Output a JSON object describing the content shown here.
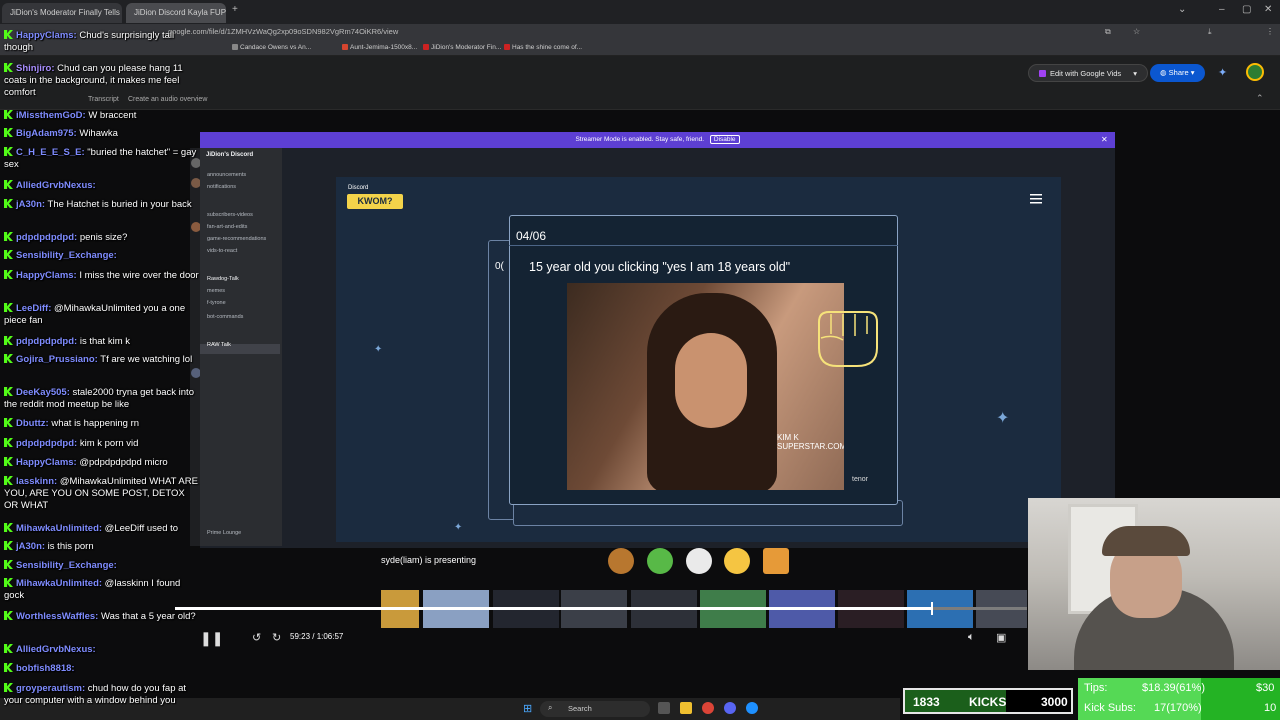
{
  "browser": {
    "tabs": [
      "JiDion's Moderator Finally Tells",
      "JiDion Discord Kayla FUP"
    ],
    "address": "google.com/file/d/1ZMHVzWaQg2xp09oSDN982VgRm74OiKR6/view",
    "bookmarks": [
      "Candace Owens vs An...",
      "Aunt-Jemima-1500x8...",
      "JiDion's Moderator Fin...",
      "Has the shine come of..."
    ]
  },
  "drive": {
    "transcript_label": "Transcript",
    "audio_overview_label": "Create an audio overview",
    "edit_vids_label": "Edit with Google Vids",
    "share_label": "Share"
  },
  "discord": {
    "streamer_banner": "Streamer Mode is enabled. Stay safe, friend.",
    "disable_label": "Disable",
    "server_name": "JiDion's Discord",
    "channels": [
      "announcements",
      "notifications",
      "subscribers-videos",
      "fan-art-and-edits",
      "game-recommendations",
      "vids-to-react",
      "Rawdog-Talk",
      "memes",
      "f-tyrone",
      "bot-commands",
      "RAW Talk"
    ],
    "voice_channel": "Prime Lounge",
    "presenting_text": "syde(liam) is presenting"
  },
  "activity": {
    "logo_small": "Discord",
    "logo": "KWOM?",
    "counter": "04/06",
    "behind_counter": "0(",
    "prompt": "15 year old you clicking \"yes I am 18 years old\"",
    "gif_watermark": "KIM K SUPERSTAR.COM",
    "gif_source": "tenor"
  },
  "player": {
    "time": "59:23 / 1:06:57",
    "progress": 0.887
  },
  "chat": [
    {
      "user": "HappyClams",
      "color": "#7f8cff",
      "text": "Chud's surprisingly tall though"
    },
    {
      "user": "Shinjiro",
      "color": "#a98fff",
      "text": "Chud can you please hang 11 coats in the background, it makes me feel comfort"
    },
    {
      "user": "iMissthemGoD",
      "color": "#7f8cff",
      "text": "W braccent"
    },
    {
      "user": "BigAdam975",
      "color": "#7f8cff",
      "text": "Wihawka"
    },
    {
      "user": "C_H_E_E_S_E",
      "color": "#7f8cff",
      "text": "\"buried the hatchet\" = gay sex"
    },
    {
      "user": "AlliedGrvbNexus",
      "color": "#7f8cff",
      "text": ""
    },
    {
      "user": "jA30n",
      "color": "#7f8cff",
      "text": "The Hatchet is buried in your back"
    },
    {
      "user": "pdpdpdpdpd",
      "color": "#7f8cff",
      "text": "penis size?"
    },
    {
      "user": "Sensibility_Exchange",
      "color": "#7f8cff",
      "text": ""
    },
    {
      "user": "HappyClams",
      "color": "#7f8cff",
      "text": "I miss the wire over the door"
    },
    {
      "user": "LeeDiff",
      "color": "#7f8cff",
      "text": "@MihawkaUnlimited you a one piece fan"
    },
    {
      "user": "pdpdpdpdpd",
      "color": "#7f8cff",
      "text": "is that kim k"
    },
    {
      "user": "Gojira_Prussiano",
      "color": "#7f8cff",
      "text": "Tf are we watching lol"
    },
    {
      "user": "DeeKay505",
      "color": "#7f8cff",
      "text": "stale2000 tryna get back into the reddit mod meetup be like"
    },
    {
      "user": "Dbuttz",
      "color": "#7f8cff",
      "text": "what is happening rn"
    },
    {
      "user": "pdpdpdpdpd",
      "color": "#7f8cff",
      "text": "kim k porn vid"
    },
    {
      "user": "HappyClams",
      "color": "#7f8cff",
      "text": "@pdpdpdpdpd micro"
    },
    {
      "user": "lasskinn",
      "color": "#7f8cff",
      "text": "@MihawkaUnlimited WHAT ARE YOU, ARE YOU ON SOME POST, DETOX OR WHAT"
    },
    {
      "user": "MihawkaUnlimited",
      "color": "#7f8cff",
      "text": "@LeeDiff used to"
    },
    {
      "user": "jA30n",
      "color": "#7f8cff",
      "text": "is this porn"
    },
    {
      "user": "Sensibility_Exchange",
      "color": "#7f8cff",
      "text": ""
    },
    {
      "user": "MihawkaUnlimited",
      "color": "#7f8cff",
      "text": "@lasskinn I found gock"
    },
    {
      "user": "WorthlessWaffles",
      "color": "#7f8cff",
      "text": "Was that a 5 year old?"
    },
    {
      "user": "AlliedGrvbNexus",
      "color": "#7f8cff",
      "text": ""
    },
    {
      "user": "bobfish8818",
      "color": "#7f8cff",
      "text": ""
    },
    {
      "user": "groyperautism",
      "color": "#7f8cff",
      "text": "chud how do you fap at your computer with a window behind you"
    }
  ],
  "kicks_widget": {
    "current": "1833",
    "label": "KICKS",
    "goal": "3000",
    "progress": 0.611
  },
  "tips_widget": {
    "tips_label": "Tips:",
    "tips_value": "$18.39(61%)",
    "tips_goal": "$30",
    "subs_label": "Kick Subs:",
    "subs_value": "17(170%)",
    "subs_goal": "10",
    "progress": 0.61
  },
  "taskbar": {
    "search_label": "Search"
  },
  "colors": {
    "kick_green": "#53fc18",
    "discord_purple": "#5d3fd3",
    "kwom_yellow": "#f3d34a",
    "share_blue": "#0b57d0"
  }
}
